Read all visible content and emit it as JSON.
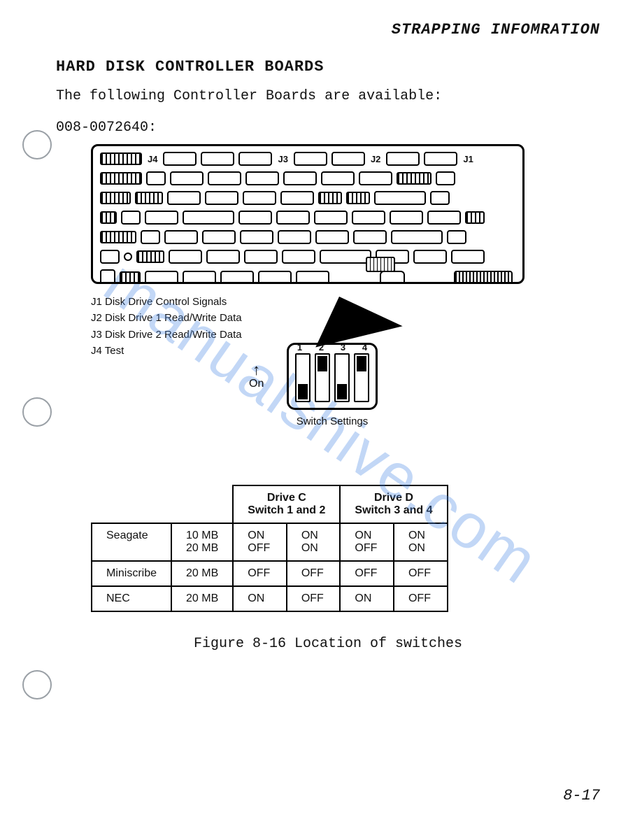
{
  "header_right": "STRAPPING INFOMRATION",
  "section_heading": "HARD DISK CONTROLLER BOARDS",
  "intro_line": "The following Controller Boards are available:",
  "part_number": "008-0072640:",
  "board_labels": {
    "j1": "J1",
    "j2": "J2",
    "j3": "J3",
    "j4": "J4"
  },
  "legend": [
    "J1 Disk Drive Control Signals",
    "J2 Disk Drive 1 Read/Write Data",
    "J3 Disk Drive 2 Read/Write Data",
    "J4 Test"
  ],
  "dip": {
    "on_label": "On",
    "numbers": [
      "1",
      "2",
      "3",
      "4"
    ],
    "states": [
      "on",
      "off",
      "on",
      "off"
    ],
    "caption": "Switch Settings"
  },
  "table": {
    "head_c": "Drive C\nSwitch 1 and 2",
    "head_d": "Drive D\nSwitch 3 and 4",
    "rows": [
      {
        "maker": "Seagate",
        "size": "10 MB\n20 MB",
        "c1": "ON\nOFF",
        "c2": "ON\nON",
        "d1": "ON\nOFF",
        "d2": "ON\nON"
      },
      {
        "maker": "Miniscribe",
        "size": "20 MB",
        "c1": "OFF",
        "c2": "OFF",
        "d1": "OFF",
        "d2": "OFF"
      },
      {
        "maker": "NEC",
        "size": "20 MB",
        "c1": "ON",
        "c2": "OFF",
        "d1": "ON",
        "d2": "OFF"
      }
    ]
  },
  "figure_caption": "Figure 8-16  Location of switches",
  "page_number": "8-17",
  "watermark": "manualshive.com"
}
